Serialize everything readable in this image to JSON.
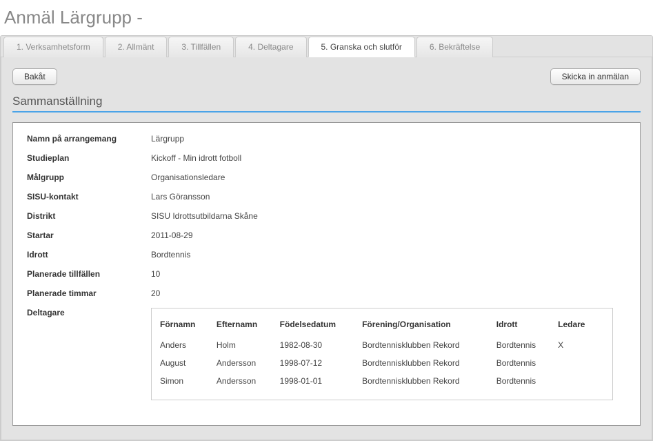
{
  "page_title": "Anmäl Lärgrupp -",
  "tabs": [
    {
      "label": "1. Verksamhetsform",
      "active": false
    },
    {
      "label": "2. Allmänt",
      "active": false
    },
    {
      "label": "3. Tillfällen",
      "active": false
    },
    {
      "label": "4. Deltagare",
      "active": false
    },
    {
      "label": "5. Granska och slutför",
      "active": true
    },
    {
      "label": "6. Bekräftelse",
      "active": false
    }
  ],
  "buttons": {
    "back": "Bakåt",
    "submit": "Skicka in anmälan"
  },
  "section_title": "Sammanställning",
  "summary": {
    "fields": [
      {
        "label": "Namn på arrangemang",
        "value": "Lärgrupp"
      },
      {
        "label": "Studieplan",
        "value": "Kickoff - Min idrott fotboll"
      },
      {
        "label": "Målgrupp",
        "value": "Organisationsledare"
      },
      {
        "label": "SISU-kontakt",
        "value": "Lars Göransson"
      },
      {
        "label": "Distrikt",
        "value": "SISU Idrottsutbildarna Skåne"
      },
      {
        "label": "Startar",
        "value": "2011-08-29"
      },
      {
        "label": "Idrott",
        "value": "Bordtennis"
      },
      {
        "label": "Planerade tillfällen",
        "value": "10"
      },
      {
        "label": "Planerade timmar",
        "value": "20"
      }
    ],
    "participants_label": "Deltagare",
    "table": {
      "headers": [
        "Förnamn",
        "Efternamn",
        "Födelsedatum",
        "Förening/Organisation",
        "Idrott",
        "Ledare"
      ],
      "rows": [
        [
          "Anders",
          "Holm",
          "1982-08-30",
          "Bordtennisklubben Rekord",
          "Bordtennis",
          "X"
        ],
        [
          "August",
          "Andersson",
          "1998-07-12",
          "Bordtennisklubben Rekord",
          "Bordtennis",
          ""
        ],
        [
          "Simon",
          "Andersson",
          "1998-01-01",
          "Bordtennisklubben Rekord",
          "Bordtennis",
          ""
        ]
      ]
    }
  }
}
